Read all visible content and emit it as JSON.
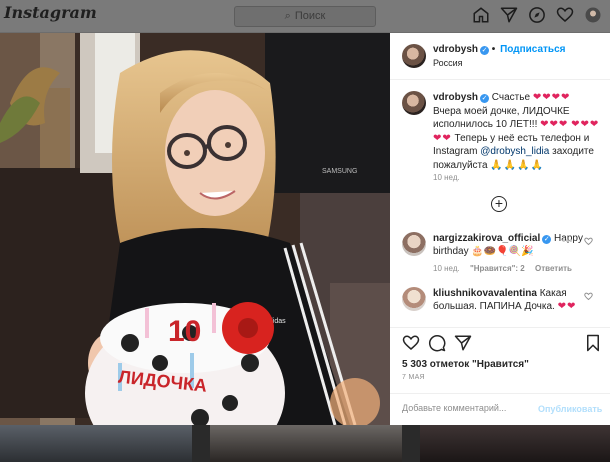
{
  "nav": {
    "logo": "Instagram",
    "search_placeholder": "Поиск",
    "icons": [
      "home-icon",
      "direct-icon",
      "explore-icon",
      "activity-icon",
      "profile-icon"
    ]
  },
  "post": {
    "author": {
      "username": "vdrobysh",
      "verified": true,
      "follow_label": "Подписаться",
      "location": "Россия"
    },
    "caption": {
      "username": "vdrobysh",
      "text_1": "Счастье",
      "hearts_1": "❤❤❤❤",
      "text_2": "Вчера моей дочке, ЛИДОЧКЕ исполнилось 10 ЛЕТ!!!",
      "hearts_2": "❤❤❤",
      "hearts_3": "❤❤❤❤❤",
      "text_3": "Теперь у неё есть телефон и Instagram",
      "mention": "@drobysh_lidia",
      "text_4": "заходите пожалуйста",
      "emoji": "🙏🙏🙏🙏",
      "time": "10 нед."
    },
    "load_more_icon": "plus-circle-icon",
    "comments": [
      {
        "username": "nargizzakirova_official",
        "verified": true,
        "text": "Happy birthday 🎂🍩🎈🍭🎉",
        "time": "10 нед.",
        "likes_label": "\"Нравится\": 2",
        "reply_label": "Ответить"
      },
      {
        "username": "kliushnikovavalentina",
        "verified": false,
        "text": "Какая большая. ПАПИНА Дочка.",
        "hearts": "❤❤"
      }
    ],
    "likes": "5 303 отметок \"Нравится\"",
    "date": "7 МАЯ",
    "comment_placeholder": "Добавьте комментарий...",
    "publish_label": "Опубликовать",
    "photo_text": {
      "cake_number": "10",
      "cake_name": "ЛИДОЧКА",
      "tv_brand": "SAMSUNG",
      "brand": "adidas"
    }
  },
  "colors": {
    "accent": "#0095f6",
    "heart": "#e0245e",
    "verified": "#3897f0",
    "muted": "#8e8e8e"
  }
}
